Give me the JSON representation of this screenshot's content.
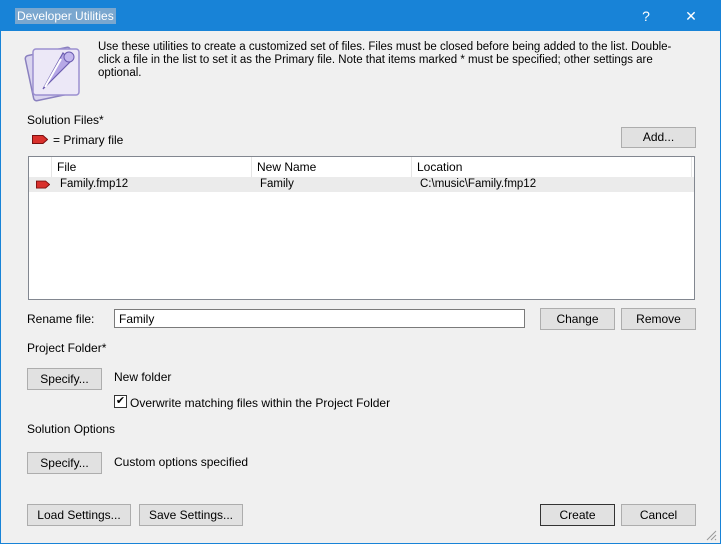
{
  "window": {
    "title": "Developer Utilities",
    "help_glyph": "?",
    "close_glyph": "✕"
  },
  "intro": "Use these utilities to create a customized set of files. Files must be closed before being added to the list. Double-click a file in the list to set it as the Primary file. Note that items marked * must be specified; other settings are optional.",
  "solution_files": {
    "heading": "Solution Files*",
    "primary_legend": "= Primary file",
    "add_label": "Add...",
    "columns": [
      "File",
      "New Name",
      "Location"
    ],
    "rows": [
      {
        "file": "Family.fmp12",
        "new_name": "Family",
        "location": "C:\\music\\Family.fmp12",
        "primary": true
      }
    ]
  },
  "rename": {
    "label": "Rename file:",
    "value": "Family",
    "change_label": "Change",
    "remove_label": "Remove"
  },
  "project_folder": {
    "heading": "Project Folder*",
    "specify_label": "Specify...",
    "value": "New folder",
    "overwrite_label": "Overwrite matching files within the Project Folder",
    "overwrite_checked": true
  },
  "solution_options": {
    "heading": "Solution Options",
    "specify_label": "Specify...",
    "value": "Custom options specified"
  },
  "footer": {
    "load_label": "Load Settings...",
    "save_label": "Save Settings...",
    "create_label": "Create",
    "cancel_label": "Cancel"
  },
  "colors": {
    "titlebar": "#1883d7",
    "primary_marker": "#d9302c"
  },
  "icons": [
    "filemaker-app-icon",
    "primary-file-marker-icon",
    "help-icon",
    "close-icon",
    "checkmark-icon",
    "resize-grip-icon"
  ]
}
